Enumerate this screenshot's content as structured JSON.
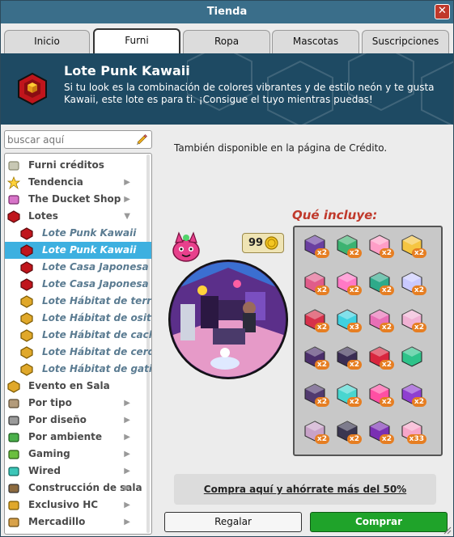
{
  "window": {
    "title": "Tienda",
    "close_label": "✕"
  },
  "tabs": [
    {
      "label": "Inicio"
    },
    {
      "label": "Furni"
    },
    {
      "label": "Ropa"
    },
    {
      "label": "Mascotas"
    },
    {
      "label": "Suscripciones"
    }
  ],
  "active_tab": "Furni",
  "banner": {
    "title": "Lote Punk Kawaii",
    "description": "Si tu look es la combinación de colores vibrantes y de estilo neón y te gusta Kawaii, este lote es para ti. ¡Consigue el tuyo mientras puedas!"
  },
  "search": {
    "placeholder": "buscar aquí",
    "value": ""
  },
  "categories": [
    {
      "label": "Furni créditos",
      "icon": "stack-icon",
      "arrow": ""
    },
    {
      "label": "Tendencia",
      "icon": "star-icon",
      "arrow": "▶"
    },
    {
      "label": "The Ducket Shop",
      "icon": "ducket-icon",
      "arrow": "▶"
    },
    {
      "label": "Lotes",
      "icon": "hexagon-red-icon",
      "arrow": "▼"
    },
    {
      "label": "Lote Punk Kawaii",
      "icon": "hexagon-red-icon",
      "arrow": "",
      "sub": true
    },
    {
      "label": "Lote Punk Kawaii",
      "icon": "hexagon-red-icon",
      "arrow": "",
      "sub": true,
      "selected": true
    },
    {
      "label": "Lote Casa Japonesa",
      "icon": "hexagon-red-icon",
      "arrow": "",
      "sub": true
    },
    {
      "label": "Lote Casa Japonesa",
      "icon": "hexagon-red-icon",
      "arrow": "",
      "sub": true
    },
    {
      "label": "Lote Hábitat de terriers",
      "icon": "hexagon-gold-icon",
      "arrow": "",
      "sub": true
    },
    {
      "label": "Lote Hábitat de osito po",
      "icon": "hexagon-gold-icon",
      "arrow": "",
      "sub": true
    },
    {
      "label": "Lote Hábitat de cachorr",
      "icon": "hexagon-gold-icon",
      "arrow": "",
      "sub": true
    },
    {
      "label": "Lote Hábitat de cerditos",
      "icon": "hexagon-gold-icon",
      "arrow": "",
      "sub": true
    },
    {
      "label": "Lote Hábitat de gatitos",
      "icon": "hexagon-gold-icon",
      "arrow": "",
      "sub": true
    },
    {
      "label": "Evento en Sala",
      "icon": "hexagon-gold-icon",
      "arrow": ""
    },
    {
      "label": "Por tipo",
      "icon": "bed-icon",
      "arrow": "▶"
    },
    {
      "label": "Por diseño",
      "icon": "columns-icon",
      "arrow": "▶"
    },
    {
      "label": "Por ambiente",
      "icon": "plant-icon",
      "arrow": "▶"
    },
    {
      "label": "Gaming",
      "icon": "gamepad-icon",
      "arrow": "▶"
    },
    {
      "label": "Wired",
      "icon": "wired-icon",
      "arrow": "▶"
    },
    {
      "label": "Construcción de sala",
      "icon": "pickaxe-icon",
      "arrow": "▶"
    },
    {
      "label": "Exclusivo HC",
      "icon": "hc-icon",
      "arrow": "▶"
    },
    {
      "label": "Mercadillo",
      "icon": "market-icon",
      "arrow": "▶"
    }
  ],
  "main": {
    "availability_text": "También disponible en la página de Crédito.",
    "includes_title": "Qué incluye:",
    "price": "99",
    "price_icon": "credit-coin-icon",
    "promo_text": "Compra aquí y ahórrate más del 50%",
    "gift_button": "Regalar",
    "buy_button": "Comprar"
  },
  "included_items": [
    {
      "icon": "purple-bookshelf-icon",
      "qty": "x2",
      "color": "#6a3fa0"
    },
    {
      "icon": "bottles-icon",
      "qty": "x2",
      "color": "#3cb371"
    },
    {
      "icon": "figure-icon",
      "qty": "x2",
      "color": "#ff9ec7"
    },
    {
      "icon": "banana-lamp-icon",
      "qty": "x2",
      "color": "#f5c542"
    },
    {
      "icon": "flower-pot-icon",
      "qty": "x2",
      "color": "#e05c8a"
    },
    {
      "icon": "pink-rug-icon",
      "qty": "x2",
      "color": "#ff79c6"
    },
    {
      "icon": "monster-plant-icon",
      "qty": "x2",
      "color": "#2eaa8a"
    },
    {
      "icon": "unicorn-icon",
      "qty": "x2",
      "color": "#c9c9ff"
    },
    {
      "icon": "roses-icon",
      "qty": "x2",
      "color": "#d6314b"
    },
    {
      "icon": "cyan-stool-icon",
      "qty": "x3",
      "color": "#3fd1e0"
    },
    {
      "icon": "pink-couch-icon",
      "qty": "x2",
      "color": "#e86fb6"
    },
    {
      "icon": "snail-icon",
      "qty": "x2",
      "color": "#f0b2d4"
    },
    {
      "icon": "dark-chair-icon",
      "qty": "x2",
      "color": "#4b2f6b"
    },
    {
      "icon": "speaker-icon",
      "qty": "x2",
      "color": "#3a2d54"
    },
    {
      "icon": "cherries-icon",
      "qty": "x2",
      "color": "#d8263e"
    },
    {
      "icon": "mushroom-lamp-icon",
      "qty": "",
      "color": "#2ec38a"
    },
    {
      "icon": "tv-shelf-icon",
      "qty": "x2",
      "color": "#513a6f"
    },
    {
      "icon": "cyan-table-icon",
      "qty": "x2",
      "color": "#48d6cf"
    },
    {
      "icon": "sparkle-icon",
      "qty": "x2",
      "color": "#ff4fa3"
    },
    {
      "icon": "purple-pouf-icon",
      "qty": "x2",
      "color": "#8f3fd0"
    },
    {
      "icon": "bow-decor-icon",
      "qty": "x2",
      "color": "#c8a2c8"
    },
    {
      "icon": "dark-bed-icon",
      "qty": "x2",
      "color": "#3a3650"
    },
    {
      "icon": "neon-poster-icon",
      "qty": "x2",
      "color": "#7a2fb3"
    },
    {
      "icon": "pink-floor-tile-icon",
      "qty": "x33",
      "color": "#f6a6c9"
    }
  ]
}
